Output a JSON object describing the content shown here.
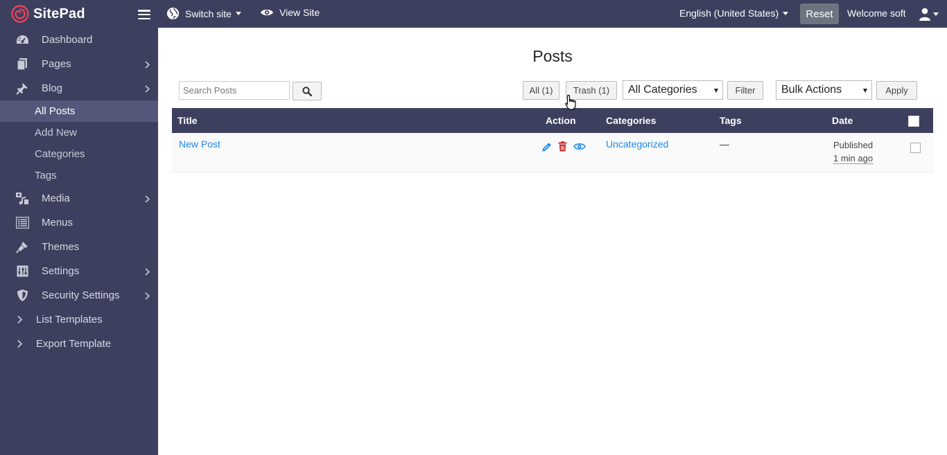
{
  "topbar": {
    "brand": "SitePad",
    "switch_site": "Switch site",
    "view_site": "View Site",
    "language": "English (United States)",
    "reset": "Reset",
    "welcome": "Welcome soft"
  },
  "sidebar": {
    "items": [
      {
        "label": "Dashboard",
        "icon": "dashboard-icon"
      },
      {
        "label": "Pages",
        "icon": "pages-icon"
      },
      {
        "label": "Blog",
        "icon": "pin-icon"
      },
      {
        "label": "Media",
        "icon": "media-icon"
      },
      {
        "label": "Menus",
        "icon": "menus-icon"
      },
      {
        "label": "Themes",
        "icon": "brush-icon"
      },
      {
        "label": "Settings",
        "icon": "settings-icon"
      },
      {
        "label": "Security Settings",
        "icon": "shield-icon"
      },
      {
        "label": "List Templates",
        "icon": "chevron-right-icon"
      },
      {
        "label": "Export Template",
        "icon": "chevron-right-icon"
      }
    ],
    "blog_sub": [
      "All Posts",
      "Add New",
      "Categories",
      "Tags"
    ]
  },
  "main": {
    "title": "Posts",
    "search_placeholder": "Search Posts",
    "all_btn": "All (1)",
    "trash_btn": "Trash (1)",
    "category_select": "All Categories",
    "filter_btn": "Filter",
    "bulk_select": "Bulk Actions",
    "apply_btn": "Apply",
    "columns": [
      "Title",
      "Action",
      "Categories",
      "Tags",
      "Date"
    ],
    "rows": [
      {
        "title": "New Post",
        "category": "Uncategorized",
        "tags": "—",
        "status": "Published",
        "ago": "1 min ago"
      }
    ]
  },
  "colors": {
    "sidebar_bg": "#3d3f5e",
    "active_item": "#55577a",
    "link": "#1e88e5",
    "delete": "#c62828",
    "reset_btn": "#6c7480"
  }
}
